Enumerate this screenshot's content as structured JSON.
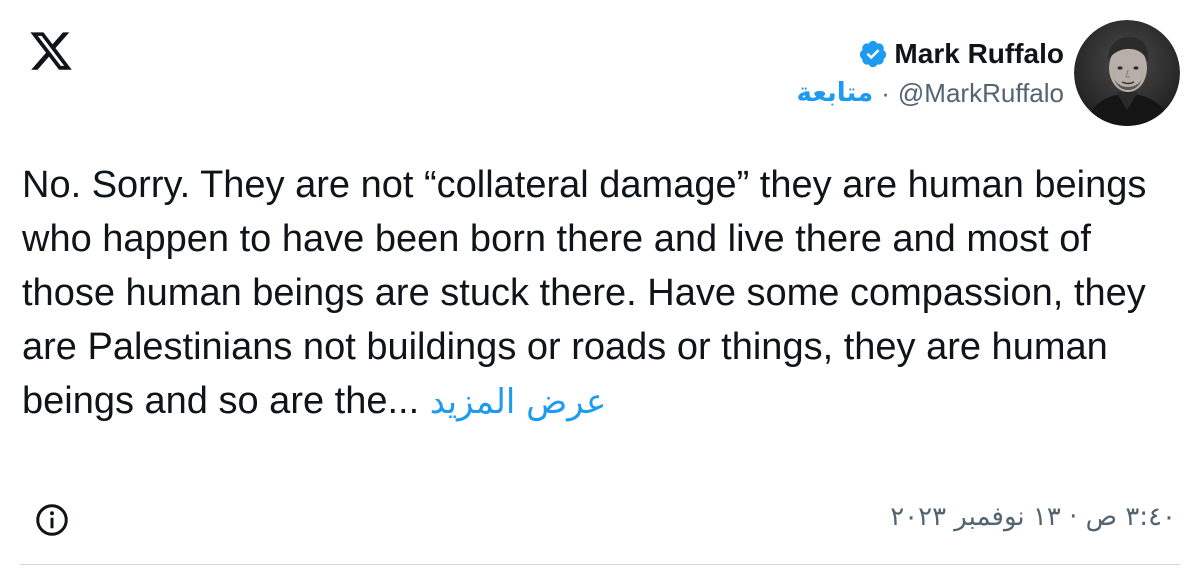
{
  "author": {
    "display_name": "Mark Ruffalo",
    "handle": "@MarkRuffalo",
    "separator": "·",
    "follow_label": "متابعة",
    "verified": true,
    "verified_color": "#1d9bf0"
  },
  "icons": {
    "logo": "x-logo-icon",
    "badge": "verified-badge-icon",
    "info": "info-icon"
  },
  "tweet": {
    "text": "No. Sorry. They are not “collateral damage” they are human beings who happen to have been born there and live there and most of those human beings are stuck there. Have some compassion, they are Palestinians not buildings or roads or things, they are human beings and so are the...",
    "show_more_label": "عرض المزيد"
  },
  "meta": {
    "timestamp": "٣:٤٠ ص · ١٣ نوفمبر ٢٠٢٣"
  },
  "colors": {
    "accent": "#1d9bf0",
    "text_primary": "#0f1419",
    "text_secondary": "#536471",
    "divider": "#cfd9de"
  }
}
